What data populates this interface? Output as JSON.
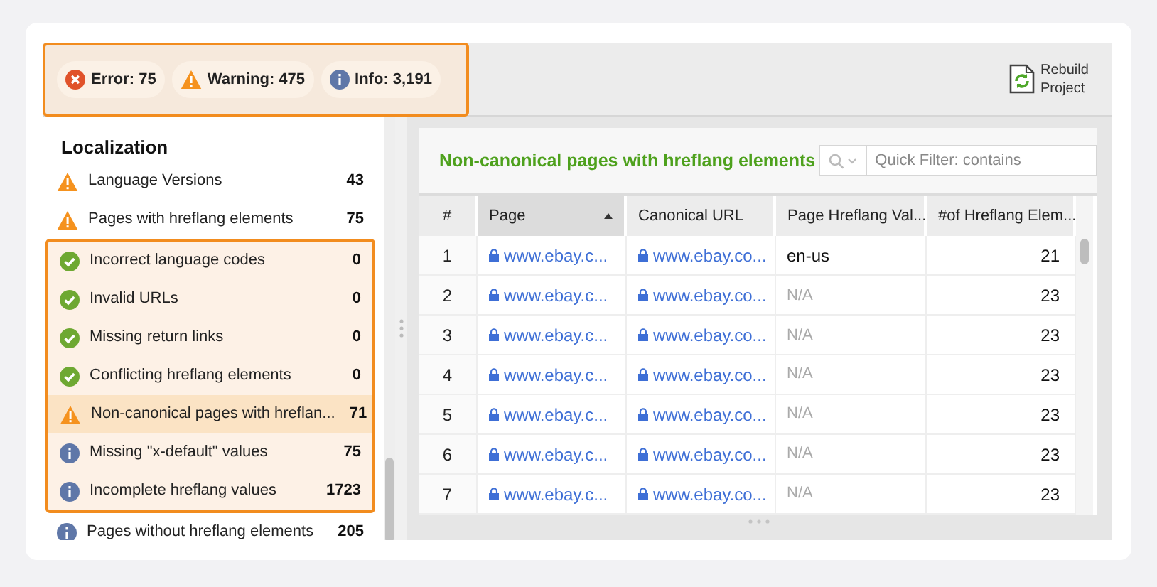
{
  "status_counts": [
    {
      "kind": "error",
      "label": "Error: 75"
    },
    {
      "kind": "warning",
      "label": "Warning: 475"
    },
    {
      "kind": "info",
      "label": "Info: 3,191"
    }
  ],
  "toolbar": {
    "rebuild_button": "Rebuild Project"
  },
  "sidebar": {
    "title": "Localization",
    "items": [
      {
        "kind": "warning",
        "label": "Language Versions",
        "count": "43",
        "selected": false,
        "highlighted": false
      },
      {
        "kind": "warning",
        "label": "Pages with hreflang elements",
        "count": "75",
        "selected": false,
        "highlighted": false
      },
      {
        "kind": "ok",
        "label": "Incorrect language codes",
        "count": "0",
        "selected": false,
        "highlighted": true
      },
      {
        "kind": "ok",
        "label": "Invalid URLs",
        "count": "0",
        "selected": false,
        "highlighted": true
      },
      {
        "kind": "ok",
        "label": "Missing return links",
        "count": "0",
        "selected": false,
        "highlighted": true
      },
      {
        "kind": "ok",
        "label": "Conflicting hreflang elements",
        "count": "0",
        "selected": false,
        "highlighted": true
      },
      {
        "kind": "warning",
        "label": "Non-canonical pages with hreflan...",
        "count": "71",
        "selected": true,
        "highlighted": true
      },
      {
        "kind": "info",
        "label": "Missing \"x-default\" values",
        "count": "75",
        "selected": false,
        "highlighted": true
      },
      {
        "kind": "info",
        "label": "Incomplete hreflang values",
        "count": "1723",
        "selected": false,
        "highlighted": true
      },
      {
        "kind": "info",
        "label": "Pages without hreflang elements",
        "count": "205",
        "selected": false,
        "highlighted": false
      }
    ]
  },
  "report": {
    "title": "Non-canonical pages with hreflang elements",
    "quick_filter": {
      "placeholder": "Quick Filter: contains"
    },
    "table": {
      "columns": [
        {
          "label": "#",
          "sorted": false
        },
        {
          "label": "Page",
          "sorted": true
        },
        {
          "label": "Canonical URL",
          "sorted": false
        },
        {
          "label": "Page Hreflang Val...",
          "sorted": false
        },
        {
          "label": "#of Hreflang Elem...",
          "sorted": false
        }
      ],
      "rows": [
        {
          "number": "1",
          "page": "www.ebay.c...",
          "canonical_url": "www.ebay.co...",
          "hreflang_value": "en-us",
          "value_missing": false,
          "elements": "21"
        },
        {
          "number": "2",
          "page": "www.ebay.c...",
          "canonical_url": "www.ebay.co...",
          "hreflang_value": "N/A",
          "value_missing": true,
          "elements": "23"
        },
        {
          "number": "3",
          "page": "www.ebay.c...",
          "canonical_url": "www.ebay.co...",
          "hreflang_value": "N/A",
          "value_missing": true,
          "elements": "23"
        },
        {
          "number": "4",
          "page": "www.ebay.c...",
          "canonical_url": "www.ebay.co...",
          "hreflang_value": "N/A",
          "value_missing": true,
          "elements": "23"
        },
        {
          "number": "5",
          "page": "www.ebay.c...",
          "canonical_url": "www.ebay.co...",
          "hreflang_value": "N/A",
          "value_missing": true,
          "elements": "23"
        },
        {
          "number": "6",
          "page": "www.ebay.c...",
          "canonical_url": "www.ebay.co...",
          "hreflang_value": "N/A",
          "value_missing": true,
          "elements": "23"
        },
        {
          "number": "7",
          "page": "www.ebay.c...",
          "canonical_url": "www.ebay.co...",
          "hreflang_value": "N/A",
          "value_missing": true,
          "elements": "23"
        }
      ]
    }
  }
}
